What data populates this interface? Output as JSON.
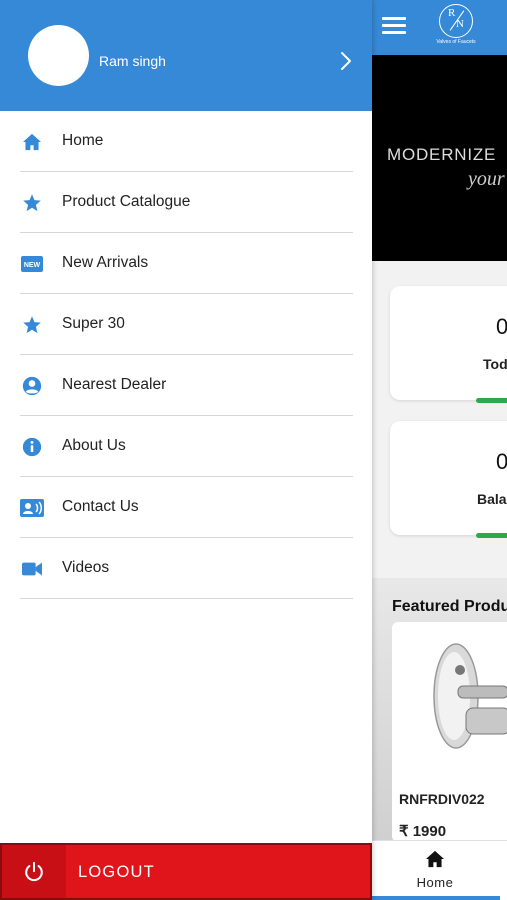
{
  "drawer": {
    "user_name": "Ram singh",
    "menu": [
      {
        "label": "Home",
        "icon": "home-icon"
      },
      {
        "label": "Product Catalogue",
        "icon": "star-icon"
      },
      {
        "label": "New Arrivals",
        "icon": "new-badge-icon"
      },
      {
        "label": "Super 30",
        "icon": "star-icon"
      },
      {
        "label": "Nearest Dealer",
        "icon": "account-circle-icon"
      },
      {
        "label": "About Us",
        "icon": "info-icon"
      },
      {
        "label": "Contact Us",
        "icon": "contact-card-icon"
      },
      {
        "label": "Videos",
        "icon": "video-camera-icon"
      }
    ],
    "logout_label": "LOGOUT",
    "new_badge_text": "NEW"
  },
  "app": {
    "logo": {
      "letter_top": "R",
      "letter_bottom": "N",
      "tagline": "Valves of Faucets"
    },
    "banner": {
      "title": "MODERNIZE",
      "script": "your"
    },
    "stats": [
      {
        "value": "0",
        "label": "Tod"
      },
      {
        "value": "0",
        "label": "Balar"
      }
    ],
    "featured": {
      "title": "Featured Produ",
      "product_code": "RNFRDIV022",
      "product_price": "₹ 1990"
    },
    "bottom_nav": {
      "home_label": "Home"
    }
  },
  "colors": {
    "primary": "#3689d6",
    "logout_red": "#e0141b",
    "progress_green": "#2ea84c"
  }
}
